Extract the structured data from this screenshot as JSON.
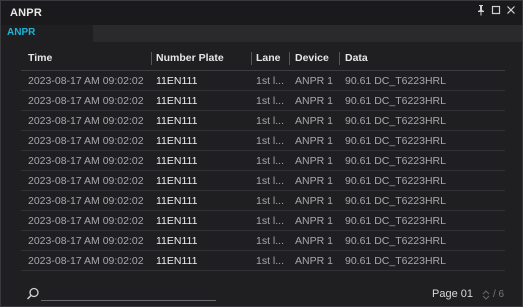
{
  "window": {
    "title": "ANPR"
  },
  "tabs": [
    {
      "label": "ANPR"
    }
  ],
  "table": {
    "columns": [
      "Time",
      "Number Plate",
      "Lane",
      "Device",
      "Data"
    ],
    "rows": [
      [
        "2023-08-17 AM 09:02:02",
        "11EN111",
        "1st l...",
        "ANPR 1",
        "90.61 DC_T6223HRL"
      ],
      [
        "2023-08-17 AM 09:02:02",
        "11EN111",
        "1st l...",
        "ANPR 1",
        "90.61 DC_T6223HRL"
      ],
      [
        "2023-08-17 AM 09:02:02",
        "11EN111",
        "1st l...",
        "ANPR 1",
        "90.61 DC_T6223HRL"
      ],
      [
        "2023-08-17 AM 09:02:02",
        "11EN111",
        "1st l...",
        "ANPR 1",
        "90.61 DC_T6223HRL"
      ],
      [
        "2023-08-17 AM 09:02:02",
        "11EN111",
        "1st l...",
        "ANPR 1",
        "90.61 DC_T6223HRL"
      ],
      [
        "2023-08-17 AM 09:02:02",
        "11EN111",
        "1st l...",
        "ANPR 1",
        "90.61 DC_T6223HRL"
      ],
      [
        "2023-08-17 AM 09:02:02",
        "11EN111",
        "1st l...",
        "ANPR 1",
        "90.61 DC_T6223HRL"
      ],
      [
        "2023-08-17 AM 09:02:02",
        "11EN111",
        "1st l...",
        "ANPR 1",
        "90.61 DC_T6223HRL"
      ],
      [
        "2023-08-17 AM 09:02:02",
        "11EN111",
        "1st l...",
        "ANPR 1",
        "90.61 DC_T6223HRL"
      ],
      [
        "2023-08-17 AM 09:02:02",
        "11EN111",
        "1st l...",
        "ANPR 1",
        "90.61 DC_T6223HRL"
      ]
    ]
  },
  "footer": {
    "page_label": "Page 01",
    "page_total": "/ 6"
  },
  "icons": {
    "pin": "pin-icon",
    "maximize": "maximize-icon",
    "close": "close-icon",
    "search": "search-icon",
    "spinner": "spinner-icon"
  },
  "colors": {
    "accent": "#1fb3d6",
    "background": "#1f1f22"
  }
}
